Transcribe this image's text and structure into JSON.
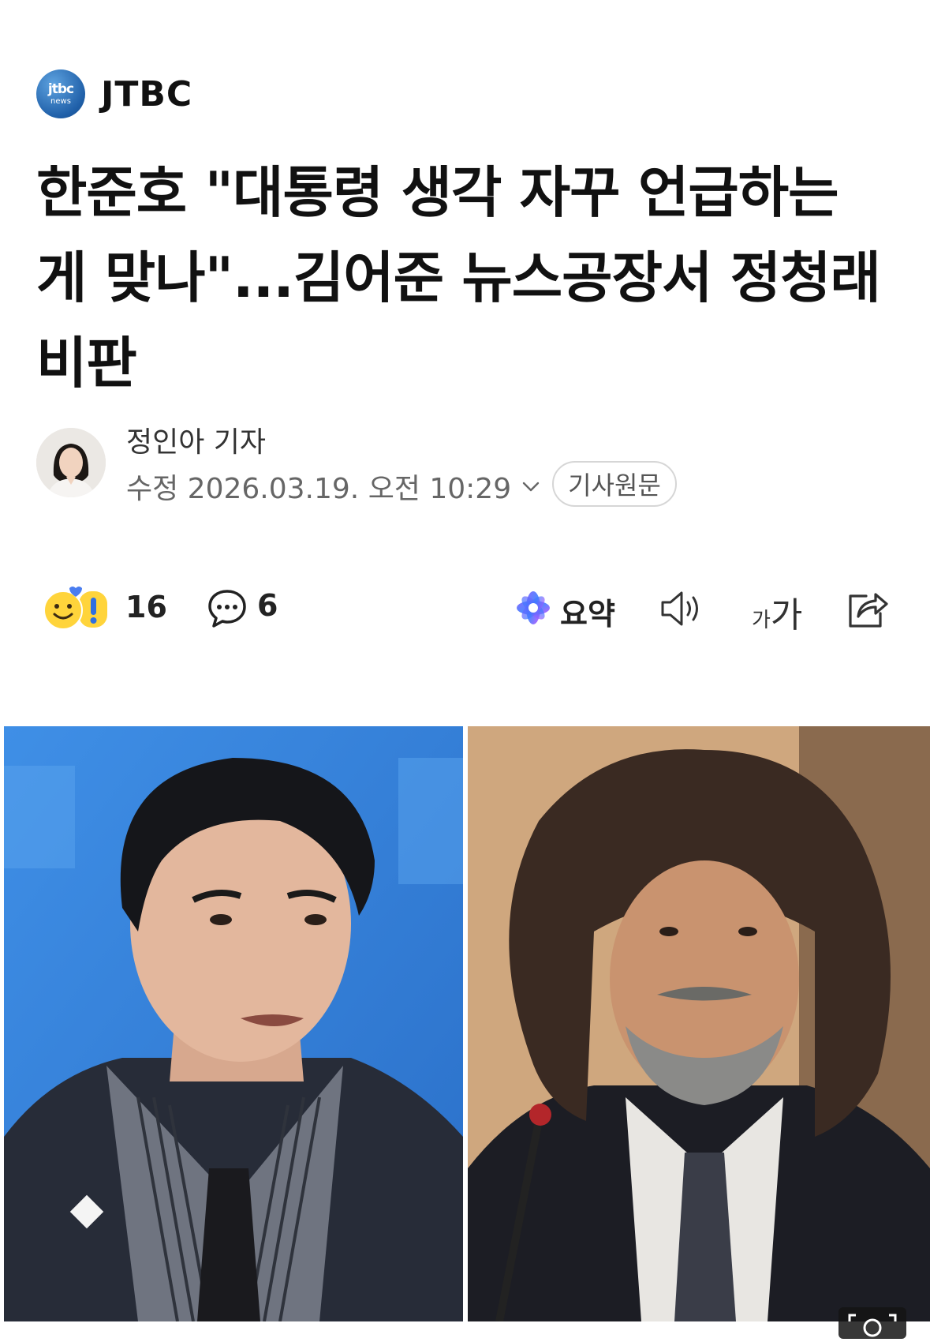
{
  "press": {
    "logo_line1": "jtbc",
    "logo_line2": "news",
    "name": "JTBC"
  },
  "article": {
    "headline": "한준호 \"대통령 생각 자꾸 언급하는 게 맞나\"...김어준 뉴스공장서 정청래 비판",
    "reporter": "정인아 기자",
    "date_text": "수정 2026.03.19. 오전 10:29",
    "original_button": "기사원문"
  },
  "actions": {
    "reaction_count": "16",
    "comment_count": "6",
    "summary_label": "요약",
    "fontsize_small": "가",
    "fontsize_large": "가"
  },
  "icons": [
    "jtbc-news-logo",
    "reaction-emoji-icon",
    "comment-icon",
    "ai-summary-icon",
    "speaker-icon",
    "font-size-icon",
    "share-icon",
    "chevron-down-icon",
    "zoom-icon"
  ]
}
